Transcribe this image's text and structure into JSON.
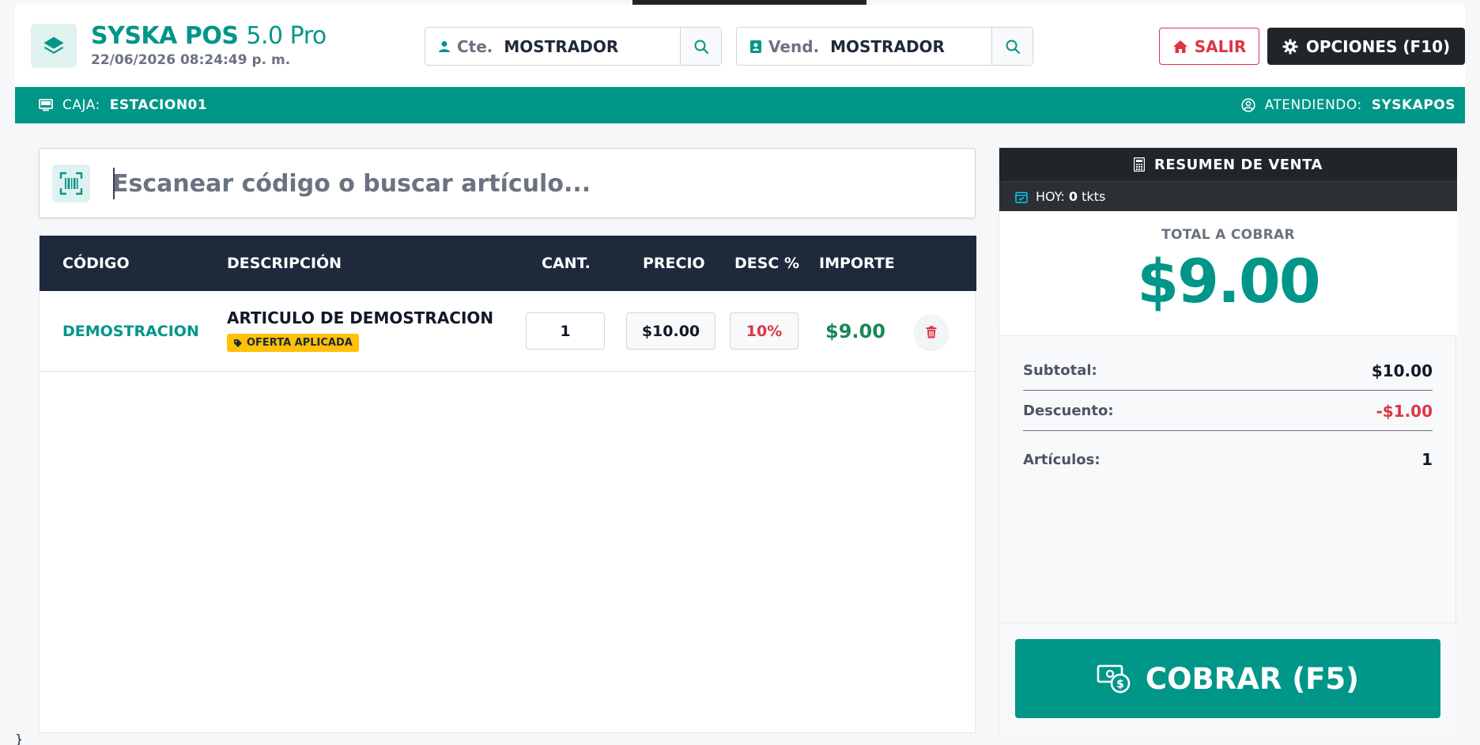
{
  "header": {
    "app_name": "SYSKA POS",
    "app_version": "5.0 Pro",
    "datetime": "22/06/2026 08:24:49 p. m.",
    "cliente_label": "Cte.",
    "cliente_value": "MOSTRADOR",
    "vendedor_label": "Vend.",
    "vendedor_value": "MOSTRADOR",
    "salir_label": "SALIR",
    "opciones_label": "OPCIONES (F10)"
  },
  "statusbar": {
    "caja_label": "CAJA:",
    "caja_value": "ESTACION01",
    "atendiendo_label": "ATENDIENDO:",
    "atendiendo_value": "SYSKAPOS"
  },
  "search": {
    "placeholder": "Escanear código o buscar artículo..."
  },
  "table": {
    "headers": {
      "codigo": "CÓDIGO",
      "descripcion": "DESCRIPCIÓN",
      "cant": "CANT.",
      "precio": "PRECIO",
      "desc": "DESC %",
      "importe": "IMPORTE"
    },
    "rows": [
      {
        "codigo": "DEMOSTRACION",
        "descripcion": "ARTICULO DE DEMOSTRACION",
        "badge": "OFERTA APLICADA",
        "cantidad": "1",
        "precio": "$10.00",
        "descuento": "10%",
        "importe": "$9.00"
      }
    ]
  },
  "summary": {
    "title": "RESUMEN DE VENTA",
    "hoy_label": "HOY:",
    "hoy_count": "0",
    "hoy_unit": "tkts",
    "total_label": "TOTAL A COBRAR",
    "total_value": "$9.00",
    "subtotal_label": "Subtotal:",
    "subtotal_value": "$10.00",
    "descuento_label": "Descuento:",
    "descuento_value": "-$1.00",
    "articulos_label": "Artículos:",
    "articulos_value": "1",
    "cobrar_label": "COBRAR (F5)"
  },
  "footer": {
    "brace": "}"
  },
  "colors": {
    "accent": "#009688",
    "dark": "#212529",
    "danger": "#dc3545",
    "success": "#198754",
    "warning": "#ffc107"
  }
}
